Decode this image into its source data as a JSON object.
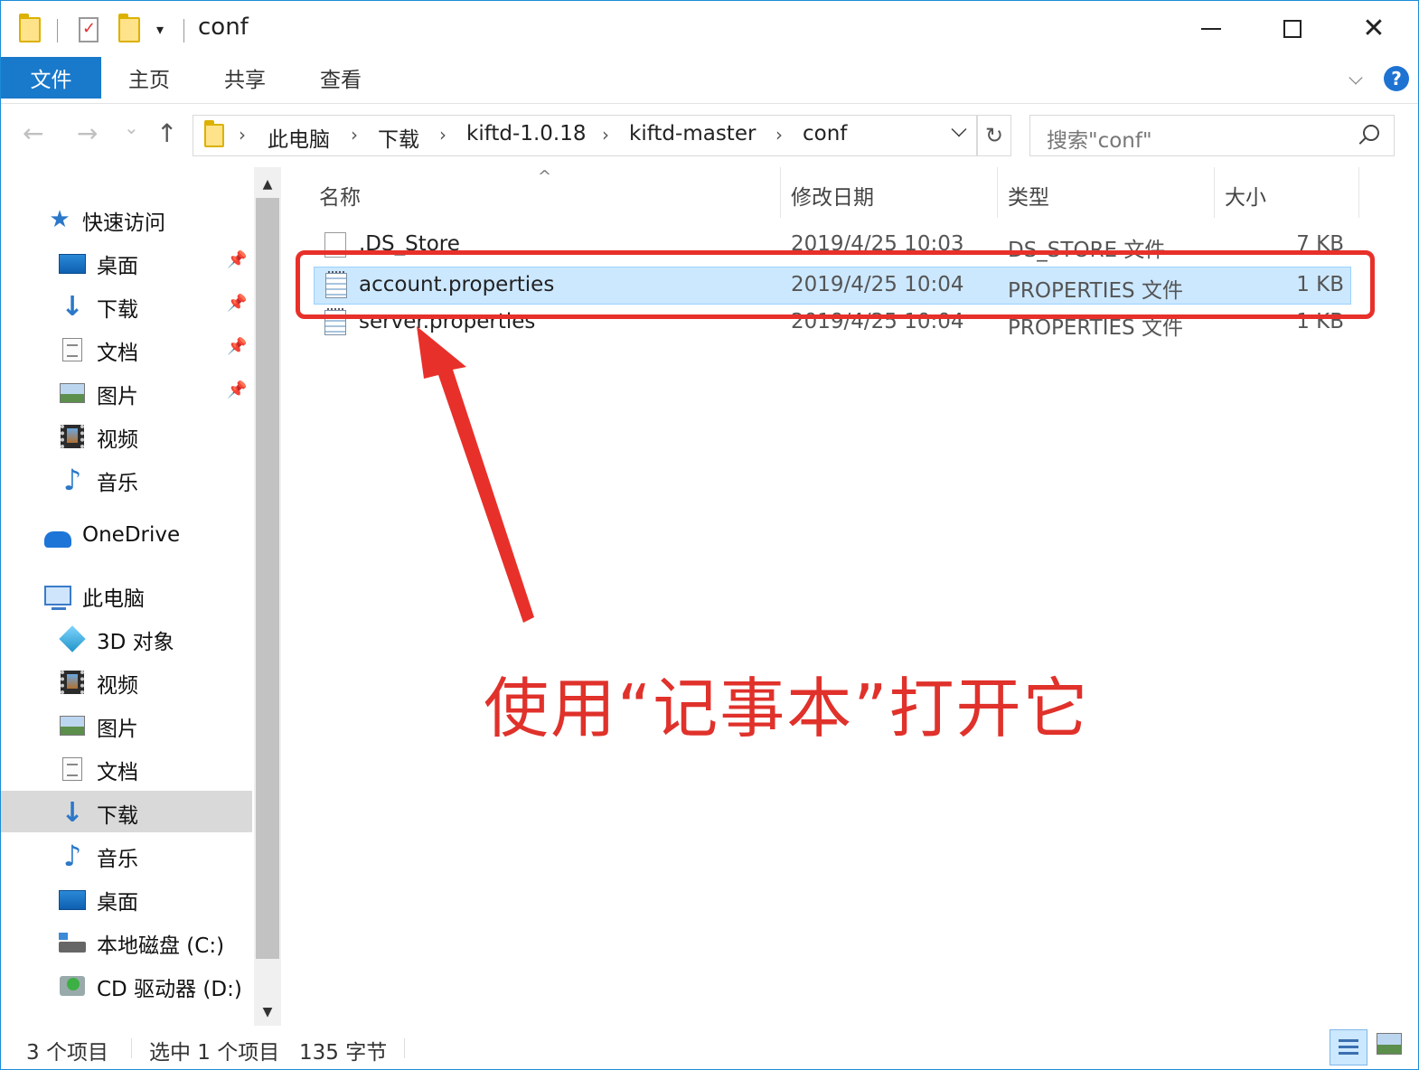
{
  "window": {
    "title": "conf",
    "quick_access_dropdown": "▾"
  },
  "ribbon": {
    "tabs": [
      "文件",
      "主页",
      "共享",
      "查看"
    ],
    "help": "?"
  },
  "nav": {
    "back": "←",
    "forward": "→",
    "recent": "⌄",
    "up": "↑"
  },
  "address": {
    "crumbs": [
      "此电脑",
      "下载",
      "kiftd-1.0.18",
      "kiftd-master",
      "conf"
    ],
    "separator": "›"
  },
  "search": {
    "placeholder": "搜索\"conf\""
  },
  "sidebar": {
    "quick_access": "快速访问",
    "quick_items": [
      "桌面",
      "下载",
      "文档",
      "图片",
      "视频",
      "音乐"
    ],
    "onedrive": "OneDrive",
    "this_pc": "此电脑",
    "pc_items": [
      "3D 对象",
      "视频",
      "图片",
      "文档",
      "下载",
      "音乐",
      "桌面",
      "本地磁盘 (C:)",
      "CD 驱动器 (D:)"
    ],
    "selected": "下载"
  },
  "columns": {
    "name": "名称",
    "modified": "修改日期",
    "type": "类型",
    "size": "大小"
  },
  "files": [
    {
      "name": ".DS_Store",
      "modified": "2019/4/25 10:03",
      "type": "DS_STORE 文件",
      "size": "7 KB"
    },
    {
      "name": "account.properties",
      "modified": "2019/4/25 10:04",
      "type": "PROPERTIES 文件",
      "size": "1 KB"
    },
    {
      "name": "server.properties",
      "modified": "2019/4/25 10:04",
      "type": "PROPERTIES 文件",
      "size": "1 KB"
    }
  ],
  "selected_file": "account.properties",
  "annotation": "使用“记事本”打开它",
  "status": {
    "count": "3 个项目",
    "selection": "选中 1 个项目",
    "size": "135 字节"
  },
  "colors": {
    "accent": "#1979ca",
    "selection": "#cce8ff",
    "annotation": "#e0312b"
  }
}
